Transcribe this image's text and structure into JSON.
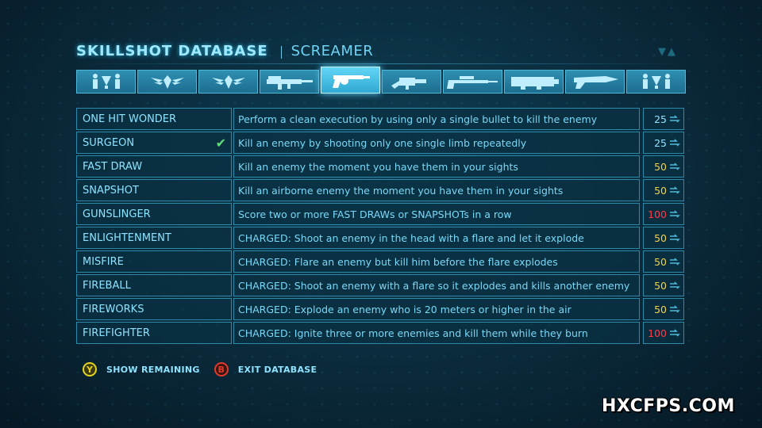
{
  "header": {
    "title": "SKILLSHOT DATABASE",
    "subtitle": "SCREAMER"
  },
  "tabs": [
    {
      "icon": "soldiers-icon",
      "active": false
    },
    {
      "icon": "winged-emblem-icon",
      "active": false
    },
    {
      "icon": "winged-emblem-icon",
      "active": false
    },
    {
      "icon": "assault-rifle-icon",
      "active": false
    },
    {
      "icon": "revolver-icon",
      "active": true
    },
    {
      "icon": "shotgun-icon",
      "active": false
    },
    {
      "icon": "sniper-rifle-icon",
      "active": false
    },
    {
      "icon": "heavy-gun-icon",
      "active": false
    },
    {
      "icon": "flail-gun-icon",
      "active": false
    },
    {
      "icon": "soldiers-icon",
      "active": false
    }
  ],
  "skillshots": [
    {
      "name": "ONE HIT WONDER",
      "desc": "Perform a clean execution by using only a single bullet to kill the enemy",
      "points": "25",
      "tier": "base",
      "completed": false
    },
    {
      "name": "SURGEON",
      "desc": "Kill an enemy by shooting only one single limb repeatedly",
      "points": "25",
      "tier": "base",
      "completed": true
    },
    {
      "name": "FAST DRAW",
      "desc": "Kill an enemy the moment you have them in your sights",
      "points": "50",
      "tier": "mid",
      "completed": false
    },
    {
      "name": "SNAPSHOT",
      "desc": "Kill an airborne enemy the moment you have them in your sights",
      "points": "50",
      "tier": "mid",
      "completed": false
    },
    {
      "name": "GUNSLINGER",
      "desc": "Score two or more FAST DRAWs or SNAPSHOTs in a row",
      "points": "100",
      "tier": "high",
      "completed": false
    },
    {
      "name": "ENLIGHTENMENT",
      "desc": "CHARGED: Shoot an enemy in the head with a flare and let it explode",
      "points": "50",
      "tier": "mid",
      "completed": false
    },
    {
      "name": "MISFIRE",
      "desc": "CHARGED: Flare an enemy but kill him before the flare explodes",
      "points": "50",
      "tier": "mid",
      "completed": false
    },
    {
      "name": "FIREBALL",
      "desc": "CHARGED: Shoot an enemy with a flare so it explodes and kills another enemy",
      "points": "50",
      "tier": "mid",
      "completed": false
    },
    {
      "name": "FIREWORKS",
      "desc": "CHARGED: Explode an enemy who is 20 meters or higher in the air",
      "points": "50",
      "tier": "mid",
      "completed": false
    },
    {
      "name": "FIREFIGHTER",
      "desc": "CHARGED: Ignite three or more enemies and kill them while they burn",
      "points": "100",
      "tier": "high",
      "completed": false
    }
  ],
  "footer": {
    "y_button": "Y",
    "y_label": "SHOW REMAINING",
    "b_button": "B",
    "b_label": "EXIT DATABASE"
  },
  "watermark": "HXCFPS.COM",
  "colors": {
    "text": "#8ee3ff",
    "points_mid": "#f1d24a",
    "points_high": "#ff3c48",
    "check": "#5de07a"
  }
}
